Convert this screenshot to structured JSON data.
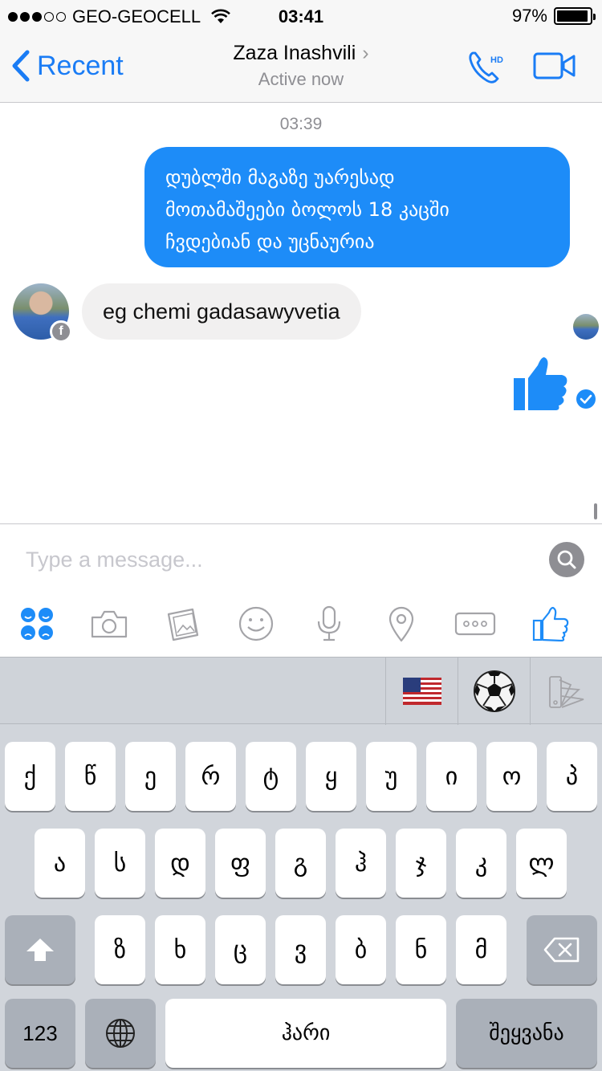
{
  "status_bar": {
    "carrier": "GEO-GEOCELL",
    "time": "03:41",
    "battery": "97%",
    "battery_level": 0.97,
    "signal_bars": 3,
    "signal_total": 5
  },
  "nav": {
    "back_label": "Recent",
    "contact_name": "Zaza Inashvili",
    "chevron": "›",
    "status": "Active now",
    "call_icon": "phone-hd-icon",
    "call_badge": "HD",
    "video_icon": "video-camera-icon"
  },
  "conversation": {
    "timestamp": "03:39",
    "messages": [
      {
        "direction": "outgoing",
        "lines": [
          "დუბლში მაგაზე უარესად",
          "მოთამაშეები ბოლოს 18 კაცში",
          "ჩვდებიან და უცნაურია"
        ]
      },
      {
        "direction": "incoming",
        "text": "eg chemi gadasawyvetia"
      },
      {
        "direction": "outgoing",
        "type": "like-sticker",
        "icon": "thumbs-up-icon"
      }
    ],
    "avatar_badge": "f"
  },
  "composer": {
    "placeholder": "Type a message...",
    "toolbar": [
      "stickers-icon",
      "camera-icon",
      "gallery-icon",
      "emoji-icon",
      "microphone-icon",
      "location-icon",
      "more-icon",
      "like-icon"
    ]
  },
  "keyboard": {
    "extensions": [
      "us-flag-icon",
      "soccer-ball-icon",
      "color-palette-icon"
    ],
    "row1": [
      "ქ",
      "წ",
      "ე",
      "რ",
      "ტ",
      "ყ",
      "უ",
      "ი",
      "ო",
      "პ"
    ],
    "row2": [
      "ა",
      "ს",
      "დ",
      "ფ",
      "გ",
      "ჰ",
      "ჯ",
      "კ",
      "ლ"
    ],
    "row3": [
      "ზ",
      "ხ",
      "ც",
      "ვ",
      "ბ",
      "ნ",
      "მ"
    ],
    "numbers_label": "123",
    "space_label": "ჰარი",
    "return_label": "შეყვანა"
  },
  "colors": {
    "accent": "#1a7cf5",
    "bubble_out": "#1d8cf8",
    "bubble_in": "#f1f0f0",
    "keyboard_bg": "#d1d5db"
  }
}
